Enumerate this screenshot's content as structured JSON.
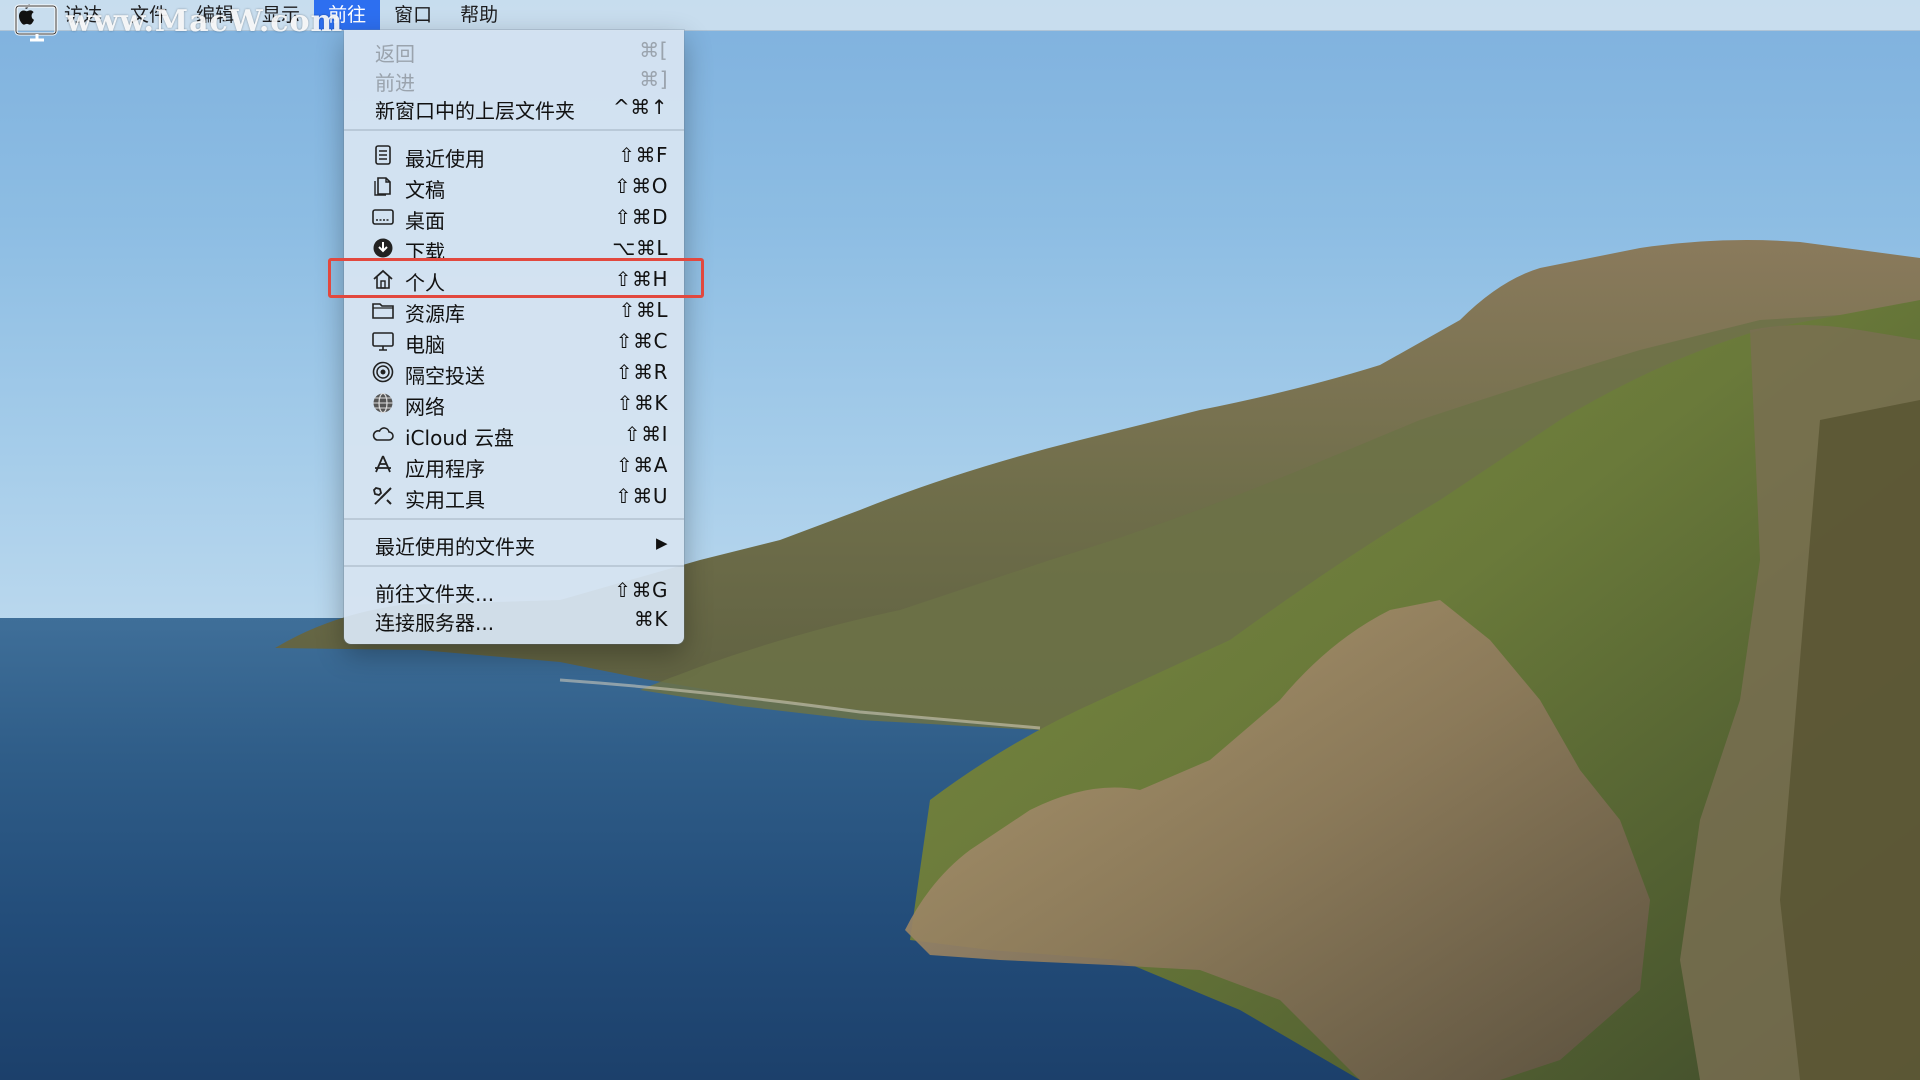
{
  "watermark": "www.MacW.com",
  "menubar": {
    "items": [
      {
        "label": "访达"
      },
      {
        "label": "文件"
      },
      {
        "label": "编辑"
      },
      {
        "label": "显示"
      },
      {
        "label": "前往",
        "active": true
      },
      {
        "label": "窗口"
      },
      {
        "label": "帮助"
      }
    ]
  },
  "go_menu": {
    "items": [
      {
        "label": "返回",
        "shortcut": "⌘[",
        "enabled": false
      },
      {
        "label": "前进",
        "shortcut": "⌘]",
        "enabled": false
      },
      {
        "label": "新窗口中的上层文件夹",
        "shortcut": "^⌘↑",
        "enabled": true
      },
      {
        "label": "最近使用",
        "shortcut": "⇧⌘F",
        "icon": "recents-icon"
      },
      {
        "label": "文稿",
        "shortcut": "⇧⌘O",
        "icon": "documents-icon"
      },
      {
        "label": "桌面",
        "shortcut": "⇧⌘D",
        "icon": "desktop-icon"
      },
      {
        "label": "下载",
        "shortcut": "⌥⌘L",
        "icon": "downloads-icon"
      },
      {
        "label": "个人",
        "shortcut": "⇧⌘H",
        "icon": "home-icon",
        "highlighted": true
      },
      {
        "label": "资源库",
        "shortcut": "⇧⌘L",
        "icon": "library-folder-icon"
      },
      {
        "label": "电脑",
        "shortcut": "⇧⌘C",
        "icon": "computer-icon"
      },
      {
        "label": "隔空投送",
        "shortcut": "⇧⌘R",
        "icon": "airdrop-icon"
      },
      {
        "label": "网络",
        "shortcut": "⇧⌘K",
        "icon": "network-icon"
      },
      {
        "label": "iCloud 云盘",
        "shortcut": "⇧⌘I",
        "icon": "icloud-icon"
      },
      {
        "label": "应用程序",
        "shortcut": "⇧⌘A",
        "icon": "applications-icon"
      },
      {
        "label": "实用工具",
        "shortcut": "⇧⌘U",
        "icon": "utilities-icon"
      },
      {
        "label": "最近使用的文件夹",
        "shortcut": "▶",
        "submenu": true
      },
      {
        "label": "前往文件夹...",
        "shortcut": "⇧⌘G"
      },
      {
        "label": "连接服务器...",
        "shortcut": "⌘K"
      }
    ]
  },
  "colors": {
    "menu_highlight": "#2d6ff0",
    "callout_box": "#e2483e"
  }
}
